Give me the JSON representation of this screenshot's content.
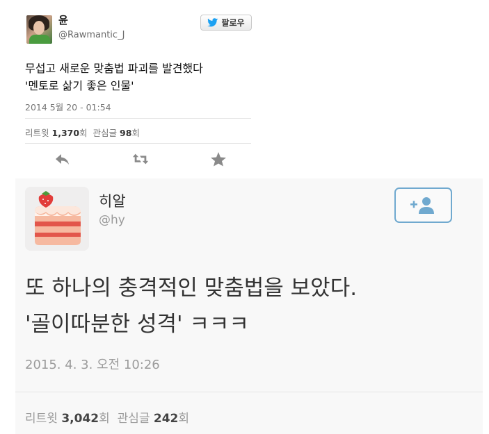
{
  "tweet1": {
    "display_name": "윤",
    "handle": "@Rawmantic_J",
    "follow_label": "팔로우",
    "text_line1": "무섭고 새로운 맞춤법 파괴를 발견했다",
    "text_line2": "'멘토로 삶기 좋은 인물'",
    "timestamp": "2014 5월 20 - 01:54",
    "retweet_label": "리트윗",
    "retweet_count": "1,370",
    "retweet_unit": "회",
    "favorite_label": "관심글",
    "favorite_count": "98",
    "favorite_unit": "회",
    "accent_color": "#1da1f2"
  },
  "tweet2": {
    "display_name": "히알",
    "handle": "@hy",
    "text_line1": "또 하나의 충격적인 맞춤법을 보았다.",
    "text_line2": "'골이따분한 성격' ㅋㅋㅋ",
    "timestamp": "2015. 4. 3. 오전 10:26",
    "retweet_label": "리트윗",
    "retweet_count": "3,042",
    "retweet_unit": "회",
    "favorite_label": "관심글",
    "favorite_count": "242",
    "favorite_unit": "회",
    "accent_color": "#70a9cf"
  },
  "icons": {
    "reply": "reply-icon",
    "retweet": "retweet-icon",
    "favorite": "star-icon",
    "bird": "twitter-bird-icon",
    "follow_user": "add-user-icon",
    "avatar2": "cake-icon"
  }
}
